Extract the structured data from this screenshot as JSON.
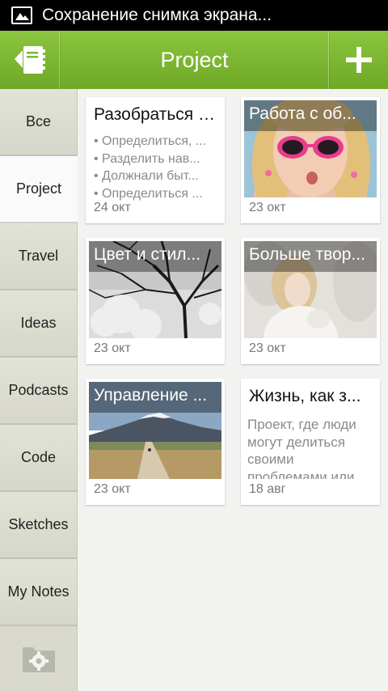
{
  "status_bar": {
    "text": "Сохранение снимка экрана..."
  },
  "action_bar": {
    "title": "Project"
  },
  "sidebar": {
    "items": [
      {
        "label": "Все",
        "active": false
      },
      {
        "label": "Project",
        "active": true
      },
      {
        "label": "Travel",
        "active": false
      },
      {
        "label": "Ideas",
        "active": false
      },
      {
        "label": "Podcasts",
        "active": false
      },
      {
        "label": "Code",
        "active": false
      },
      {
        "label": "Sketches",
        "active": false
      },
      {
        "label": "My Notes",
        "active": false
      }
    ]
  },
  "notes": [
    {
      "title": "Разобраться с...",
      "bullets": [
        "• Определиться, ...",
        "• Разделить нав...",
        "• Должнали быт...",
        "• Определиться ..."
      ],
      "date": "24 окт"
    },
    {
      "title": "Работа с об...",
      "date": "23 окт"
    },
    {
      "title": "Цвет и стил...",
      "date": "23 окт"
    },
    {
      "title": "Больше твор...",
      "date": "23 окт"
    },
    {
      "title": "Управление ...",
      "date": "23 окт"
    },
    {
      "title": "Жизнь, как з...",
      "description": "Проект, где люди могут делиться своими проблемами или",
      "date": "18 авг"
    }
  ],
  "colors": {
    "accent": "#7db732",
    "sidebar_bg": "#d9dacd",
    "content_bg": "#f2f2f0"
  },
  "icons": {
    "status": "image-icon",
    "notebook": "notebook-icon",
    "add": "plus-icon",
    "settings": "gear-folder-icon"
  }
}
